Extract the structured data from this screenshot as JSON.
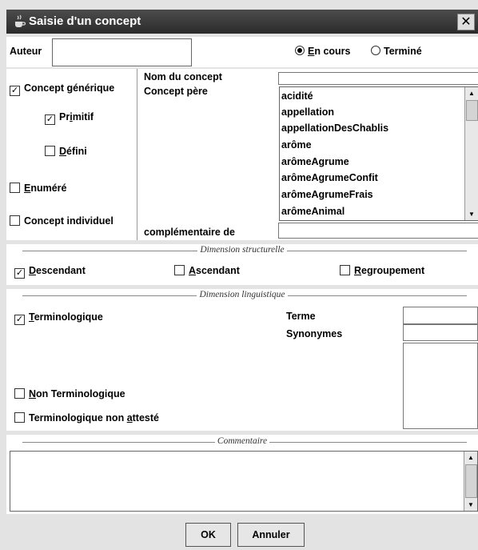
{
  "window": {
    "title": "Saisie d'un concept",
    "close": "✕"
  },
  "header": {
    "author_label": "Auteur",
    "author_value": "",
    "status_options": [
      {
        "label_pre": "",
        "label_u": "E",
        "label_post": "n cours",
        "selected": true
      },
      {
        "label_pre": "",
        "label_u": "",
        "label_post": "Terminé",
        "selected": false
      }
    ]
  },
  "concept": {
    "generic": {
      "label_pre": "",
      "label_u": "",
      "label_post": "Concept générique",
      "checked": true
    },
    "primitif": {
      "label_pre": "Pr",
      "label_u": "i",
      "label_post": "mitif",
      "checked": true
    },
    "defini": {
      "label_pre": "",
      "label_u": "D",
      "label_post": "éfini",
      "checked": false
    },
    "enumere": {
      "label_pre": "",
      "label_u": "E",
      "label_post": "numéré",
      "checked": false
    },
    "individuel": {
      "label_pre": "",
      "label_u": "",
      "label_post": "Concept individuel",
      "checked": false
    },
    "name_label": "Nom du concept",
    "name_value": "",
    "father_label": "Concept père",
    "father_list": [
      "acidité",
      "appellation",
      "appellationDesChablis",
      "arôme",
      "arômeAgrume",
      "arômeAgrumeConfit",
      "arômeAgrumeFrais",
      "arômeAnimal"
    ],
    "complement_label": "complémentaire de",
    "complement_value": ""
  },
  "structural": {
    "legend": "Dimension structurelle",
    "descendant": {
      "label_pre": "",
      "label_u": "D",
      "label_post": "escendant",
      "checked": true
    },
    "ascendant": {
      "label_pre": "",
      "label_u": "A",
      "label_post": "scendant",
      "checked": false
    },
    "regroupement": {
      "label_pre": "",
      "label_u": "R",
      "label_post": "egroupement",
      "checked": false
    }
  },
  "linguistic": {
    "legend": "Dimension linguistique",
    "terminologique": {
      "label_pre": "",
      "label_u": "T",
      "label_post": "erminologique",
      "checked": true
    },
    "non_terminologique": {
      "label_pre": "",
      "label_u": "N",
      "label_post": "on Terminologique",
      "checked": false
    },
    "non_atteste": {
      "label_pre": "Terminologique non ",
      "label_u": "a",
      "label_post": "ttesté",
      "checked": false
    },
    "terme_label": "Terme",
    "terme_value": "",
    "synonymes_label": "Synonymes",
    "synonymes_value": ""
  },
  "comment": {
    "legend": "Commentaire",
    "value": ""
  },
  "buttons": {
    "ok": "OK",
    "cancel": "Annuler"
  },
  "icons": {
    "app": "java-cup-icon",
    "close": "close-icon",
    "scroll_up": "arrow-up-icon",
    "scroll_down": "arrow-down-icon"
  }
}
